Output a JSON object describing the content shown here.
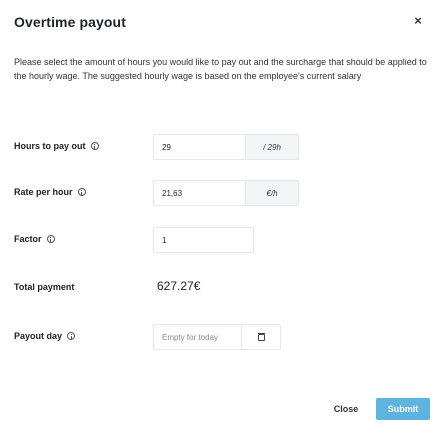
{
  "modal": {
    "title": "Overtime payout",
    "description": "Please select the amount of hours you would like to pay out and the surcharge that should be applied to the hourly wage. The suggested hourly wage is based on the employee's current salary"
  },
  "form": {
    "hours": {
      "label": "Hours to pay out",
      "value": "29",
      "addon": "/ 29h"
    },
    "rate": {
      "label": "Rate per hour",
      "value": "21,63",
      "addon": "€/h"
    },
    "factor": {
      "label": "Factor",
      "value": "1"
    },
    "total": {
      "label": "Total payment",
      "value": "627.27€"
    },
    "payout_day": {
      "label": "Payout day",
      "placeholder": "Empty for today"
    }
  },
  "footer": {
    "close_label": "Close",
    "submit_label": "Submit"
  },
  "colors": {
    "submit_bg": "#5fb3e0",
    "addon_bg": "#f4f5f7",
    "border": "#e4e7eb"
  },
  "icons": {
    "close": "close-icon",
    "info": "info-icon",
    "calendar": "calendar-icon"
  }
}
